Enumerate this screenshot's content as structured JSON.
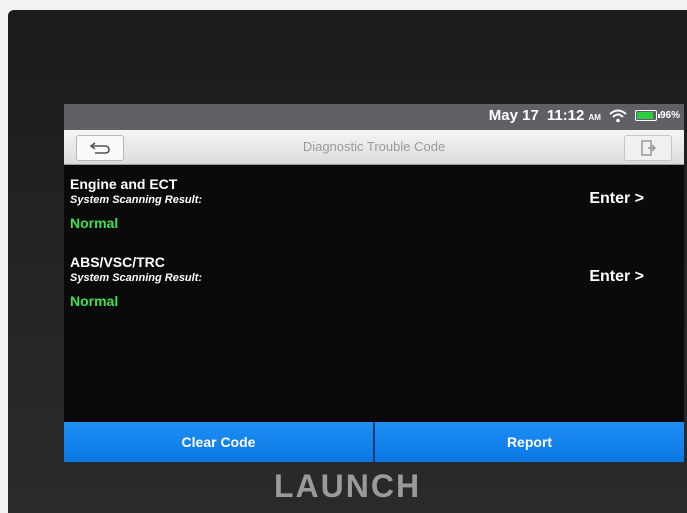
{
  "status_bar": {
    "date": "May 17",
    "time": "11:12",
    "ampm": "AM",
    "battery": "96%",
    "battery_level": 0.96
  },
  "title_bar": {
    "title": "Diagnostic Trouble Code",
    "back_icon": "back-arrow-icon",
    "exit_icon": "exit-icon"
  },
  "systems": [
    {
      "name": "Engine and ECT",
      "subtitle": "System Scanning Result:",
      "status": "Normal",
      "action": "Enter >"
    },
    {
      "name": "ABS/VSC/TRC",
      "subtitle": "System Scanning Result:",
      "status": "Normal",
      "action": "Enter >"
    }
  ],
  "bottom_buttons": {
    "clear_code": "Clear Code",
    "report": "Report"
  },
  "brand": "LAUNCH",
  "colors": {
    "accent_blue": "#0a78e3",
    "status_green": "#3ee24b",
    "status_bar": "#5f6066"
  }
}
